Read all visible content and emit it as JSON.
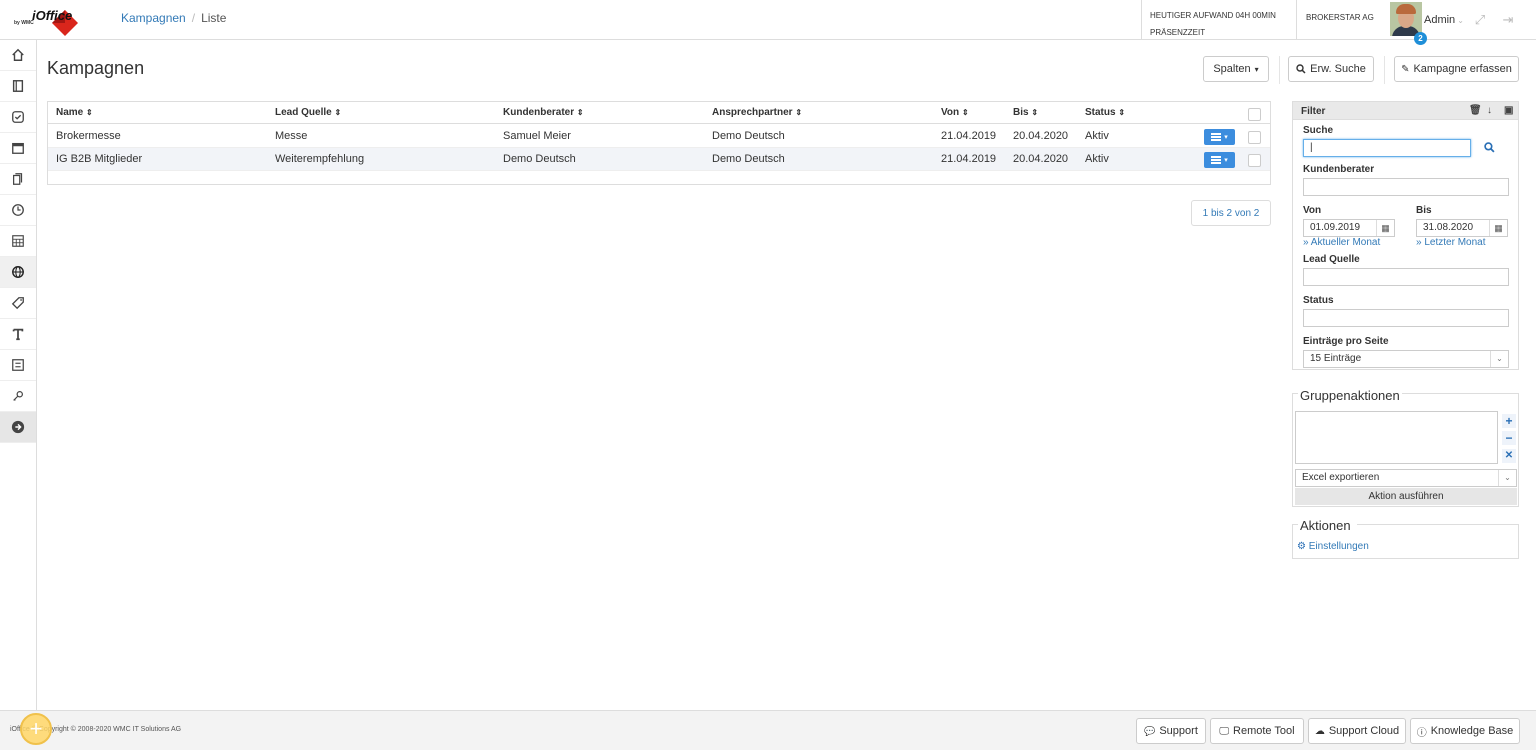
{
  "app": {
    "logo_name": "iOffice",
    "logo_by": "by WMC"
  },
  "breadcrumb": {
    "parent": "Kampagnen",
    "separator": "/",
    "current": "Liste"
  },
  "header": {
    "aufwand_line1": "HEUTIGER AUFWAND 04H 00MIN",
    "aufwand_line2": "PRÄSENZZEIT",
    "company": "BROKERSTAR AG",
    "user": "Admin",
    "notification_count": "2"
  },
  "sidebar": {
    "items": [
      {
        "icon": "home-icon"
      },
      {
        "icon": "book-icon"
      },
      {
        "icon": "check-circle-icon"
      },
      {
        "icon": "calendar-icon"
      },
      {
        "icon": "documents-icon"
      },
      {
        "icon": "clock-icon"
      },
      {
        "icon": "table-icon"
      },
      {
        "icon": "globe-icon",
        "active": true
      },
      {
        "icon": "tag-icon"
      },
      {
        "icon": "text-icon"
      },
      {
        "icon": "list-box-icon"
      },
      {
        "icon": "key-icon"
      },
      {
        "icon": "arrow-right-circle-icon"
      }
    ]
  },
  "page": {
    "title": "Kampagnen"
  },
  "toolbar": {
    "columns_label": "Spalten",
    "search_label": "Erw. Suche",
    "create_label": "Kampagne erfassen"
  },
  "table": {
    "columns": [
      "Name",
      "Lead Quelle",
      "Kundenberater",
      "Ansprechpartner",
      "Von",
      "Bis",
      "Status"
    ],
    "rows": [
      {
        "name": "Brokermesse",
        "lead": "Messe",
        "berater": "Samuel Meier",
        "ansprech": "Demo Deutsch",
        "von": "21.04.2019",
        "bis": "20.04.2020",
        "status": "Aktiv"
      },
      {
        "name": "IG B2B Mitglieder",
        "lead": "Weiterempfehlung",
        "berater": "Demo Deutsch",
        "ansprech": "Demo Deutsch",
        "von": "21.04.2019",
        "bis": "20.04.2020",
        "status": "Aktiv"
      }
    ],
    "pager": "1 bis 2 von 2"
  },
  "filter": {
    "title": "Filter",
    "suche_label": "Suche",
    "suche_value": "|",
    "kundenberater_label": "Kundenberater",
    "von_label": "Von",
    "von_value": "01.09.2019",
    "von_link": "» Aktueller Monat",
    "bis_label": "Bis",
    "bis_value": "31.08.2020",
    "bis_link": "» Letzter Monat",
    "lead_label": "Lead Quelle",
    "status_label": "Status",
    "entries_label": "Einträge pro Seite",
    "entries_value": "15 Einträge"
  },
  "group_actions": {
    "title": "Gruppenaktionen",
    "select_value": "Excel exportieren",
    "run_label": "Aktion ausführen"
  },
  "actions": {
    "title": "Aktionen",
    "settings_label": "Einstellungen"
  },
  "footer": {
    "copyright": "iOffice © Copyright © 2008-2020 WMC IT Solutions AG",
    "support": "Support",
    "remote": "Remote Tool",
    "cloud": "Support Cloud",
    "kb": "Knowledge Base"
  },
  "colors": {
    "accent": "#337ab7",
    "row_button": "#3c8dde",
    "logo_red": "#d9261c"
  }
}
